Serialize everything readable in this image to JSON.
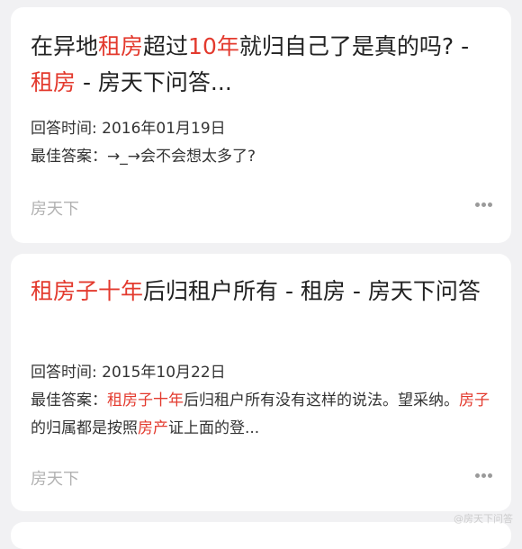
{
  "results": [
    {
      "title_segments": [
        {
          "text": "在异地",
          "hl": false
        },
        {
          "text": "租房",
          "hl": true
        },
        {
          "text": "超过",
          "hl": false
        },
        {
          "text": "10年",
          "hl": true
        },
        {
          "text": "就归自己了是真的吗? - ",
          "hl": false
        },
        {
          "text": "租房",
          "hl": true
        },
        {
          "text": " - 房天下问答...",
          "hl": false
        }
      ],
      "answer_time": "回答时间: 2016年01月19日",
      "best_answer_segments": [
        {
          "text": "最佳答案：→_→会不会想太多了?",
          "hl": false
        }
      ],
      "source": "房天下"
    },
    {
      "title_segments": [
        {
          "text": "租房子十年",
          "hl": true
        },
        {
          "text": "后归租户所有 - 租房 - 房天下问答",
          "hl": false
        }
      ],
      "answer_time": "回答时间: 2015年10月22日",
      "best_answer_segments": [
        {
          "text": "最佳答案：",
          "hl": false
        },
        {
          "text": "租房子十年",
          "hl": true
        },
        {
          "text": "后归租户所有没有这样的说法。望采纳。",
          "hl": false
        },
        {
          "text": "房子",
          "hl": true
        },
        {
          "text": "的归属都是按照",
          "hl": false
        },
        {
          "text": "房产",
          "hl": true
        },
        {
          "text": "证上面的登...",
          "hl": false
        }
      ],
      "source": "房天下"
    }
  ],
  "watermark": "@房天下问答",
  "colors": {
    "highlight": "#e33a2e",
    "background": "#f1f1f3",
    "card": "#ffffff",
    "source_text": "#b2b2b2"
  },
  "icons": {
    "more": "more-dots-icon"
  }
}
